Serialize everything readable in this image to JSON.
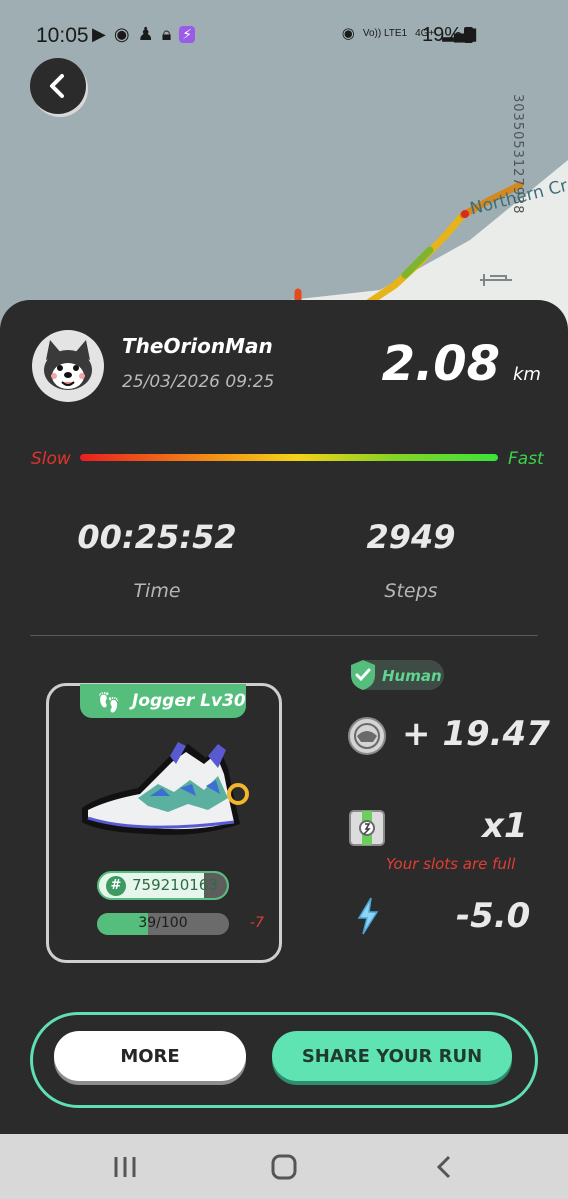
{
  "status_bar": {
    "time": "10:05",
    "network": "Vo)) LTE1",
    "data": "4G+",
    "battery": "19%"
  },
  "map": {
    "id_text": "3035053127938",
    "street_label": "Northern Cr"
  },
  "profile": {
    "username": "TheOrionMan",
    "datetime": "25/03/2026 09:25",
    "distance": "2.08",
    "distance_unit": "km"
  },
  "speed_bar": {
    "slow_label": "Slow",
    "fast_label": "Fast"
  },
  "stats": {
    "time_value": "00:25:52",
    "time_label": "Time",
    "steps_value": "2949",
    "steps_label": "Steps"
  },
  "sneaker": {
    "type_label": "Jogger Lv30",
    "id": "759210163",
    "durability_text": "39/100",
    "durability_fraction": 0.39,
    "durability_change": "-7"
  },
  "rewards": {
    "human_label": "Human",
    "gst_value": "+ 19.47",
    "box_value": "x1",
    "slots_message": "Your slots are full",
    "energy_value": "-5.0"
  },
  "buttons": {
    "more_label": "MORE",
    "share_label": "SHARE YOUR RUN"
  },
  "colors": {
    "accent": "#5fe3b3",
    "jogger_green": "#56be7c",
    "warning_red": "#e23d34"
  }
}
